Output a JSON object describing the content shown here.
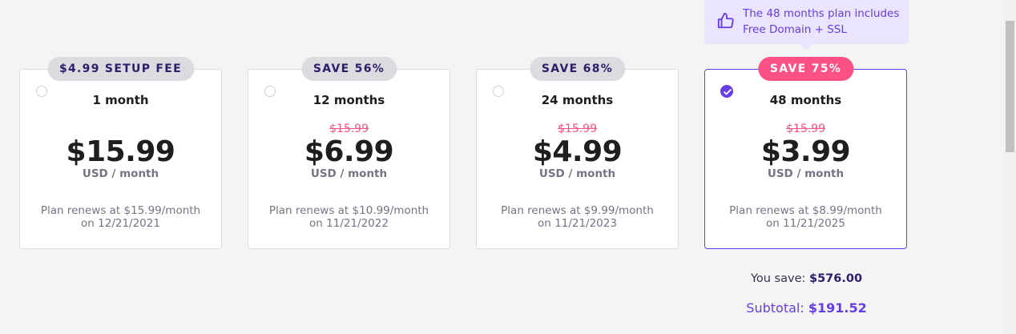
{
  "tooltip": {
    "line1": "The 48 months plan includes",
    "line2": "Free Domain + SSL",
    "icon": "thumbs-up-icon"
  },
  "plans": [
    {
      "badge": "$4.99 SETUP FEE",
      "term": "1 month",
      "old_price": "",
      "price": "$15.99",
      "unit": "USD / month",
      "renew_line1": "Plan renews at $15.99/month",
      "renew_line2": "on 12/21/2021",
      "selected": false
    },
    {
      "badge": "SAVE 56%",
      "term": "12 months",
      "old_price": "$15.99",
      "price": "$6.99",
      "unit": "USD / month",
      "renew_line1": "Plan renews at $10.99/month",
      "renew_line2": "on 11/21/2022",
      "selected": false
    },
    {
      "badge": "SAVE 68%",
      "term": "24 months",
      "old_price": "$15.99",
      "price": "$4.99",
      "unit": "USD / month",
      "renew_line1": "Plan renews at $9.99/month",
      "renew_line2": "on 11/21/2023",
      "selected": false
    },
    {
      "badge": "SAVE 75%",
      "term": "48 months",
      "old_price": "$15.99",
      "price": "$3.99",
      "unit": "USD / month",
      "renew_line1": "Plan renews at $8.99/month",
      "renew_line2": "on 11/21/2025",
      "selected": true
    }
  ],
  "summary": {
    "you_save_label": "You save:",
    "you_save_value": "$576.00",
    "subtotal_label": "Subtotal:",
    "subtotal_value": "$191.52"
  },
  "colors": {
    "accent": "#673de6",
    "sale": "#fc5185",
    "badge_gray": "#dadce0",
    "tooltip_bg": "#ebe4ff"
  }
}
